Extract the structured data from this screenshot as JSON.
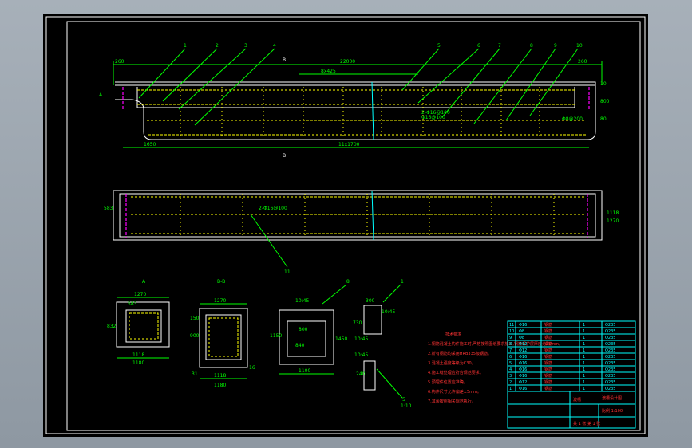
{
  "drawing": {
    "top_dims": {
      "left": "260",
      "overall": "22000",
      "spacing": "8x425",
      "right": "260",
      "height1": "10",
      "height2": "800",
      "height3": "80",
      "bottom": "11x1700",
      "left_bottom": "1650"
    },
    "section_marks": {
      "b_top": "B",
      "b_bottom": "B",
      "a_left": "A"
    },
    "callouts": [
      "1",
      "2",
      "3",
      "4",
      "5",
      "6",
      "7",
      "8",
      "9",
      "10",
      "11"
    ],
    "callout_11": "11",
    "pipe_labels": {
      "main": "2-Φ16@100",
      "sub": "Φ16@100",
      "right": "Φ8@200"
    },
    "plan_dims": {
      "width": "583",
      "right1": "1118",
      "right2": "1270"
    },
    "sec_a": {
      "label": "A",
      "w_top": "1270",
      "inner": "583",
      "h": "832",
      "w_bot1": "1118",
      "w_bot2": "1180"
    },
    "sec_bb": {
      "label": "B-B",
      "w_top": "1270",
      "h1": "150",
      "h2": "900",
      "w_bot1": "1118",
      "w_bot2": "1180",
      "side": "31",
      "side2": "16"
    },
    "sec_8": {
      "label": "8",
      "slope": "10:45",
      "top": "800",
      "h": "1450",
      "inner": "840",
      "bot": "1100",
      "left": "1150"
    },
    "sec_1": {
      "label": "1",
      "w": "300",
      "h": "730",
      "ang": "10:45",
      "ang2": "10:45",
      "num": "5",
      "h2": "240",
      "scale": "1:10"
    },
    "notes_title": "技术要求",
    "notes": [
      "1.钢筋混凝土构件施工时,严格按照图纸要求施工,钢筋保护层厚度为25mm。",
      "2.所有钢筋均采用HRB335级钢筋。",
      "3.混凝土强度等级为C30。",
      "4.施工缝处理应符合规范要求。",
      "5.预埋件位置应准确。",
      "6.构件尺寸允许偏差±5mm。",
      "7.其余按照相关规范执行。"
    ],
    "title_block": {
      "drawing_name": "渡槽",
      "project": "渡槽设计图",
      "scale": "比例 1:100",
      "sheet": "共 1 张 第 1 张"
    },
    "bom_rows": [
      [
        "11",
        "Φ16",
        "钢筋",
        "1",
        "Q235"
      ],
      [
        "10",
        "Φ8",
        "钢筋",
        "1",
        "Q235"
      ],
      [
        "9",
        "Φ8",
        "钢筋",
        "1",
        "Q235"
      ],
      [
        "8",
        "Φ12",
        "钢筋",
        "1",
        "Q235"
      ],
      [
        "7",
        "Φ12",
        "钢筋",
        "1",
        "Q235"
      ],
      [
        "6",
        "Φ16",
        "钢筋",
        "1",
        "Q235"
      ],
      [
        "5",
        "Φ16",
        "钢筋",
        "1",
        "Q235"
      ],
      [
        "4",
        "Φ16",
        "钢筋",
        "1",
        "Q235"
      ],
      [
        "3",
        "Φ16",
        "钢筋",
        "1",
        "Q235"
      ],
      [
        "2",
        "Φ12",
        "钢筋",
        "1",
        "Q235"
      ],
      [
        "1",
        "Φ16",
        "钢筋",
        "1",
        "Q235"
      ]
    ],
    "colors": {
      "background": "#000000",
      "frame": "#9aa3ad",
      "rebar": "#ffff00",
      "outline": "#ffffff",
      "dims": "#00ff00"
    }
  }
}
